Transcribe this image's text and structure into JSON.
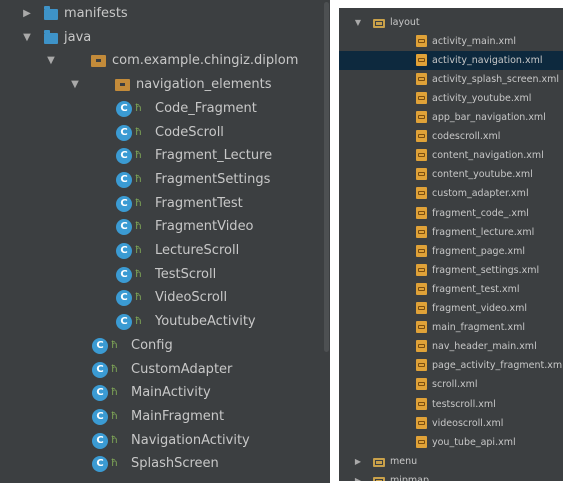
{
  "left_tree": [
    {
      "label": "manifests",
      "indent": 0,
      "type": "folder",
      "arrow": "collapsed"
    },
    {
      "label": "java",
      "indent": 0,
      "type": "folder",
      "arrow": "expanded"
    },
    {
      "label": "com.example.chingiz.diplom",
      "indent": 1,
      "type": "package",
      "arrow": "expanded"
    },
    {
      "label": "navigation_elements",
      "indent": 2,
      "type": "package",
      "arrow": "expanded"
    },
    {
      "label": "Code_Fragment",
      "indent": 3,
      "type": "class"
    },
    {
      "label": "CodeScroll",
      "indent": 3,
      "type": "class"
    },
    {
      "label": "Fragment_Lecture",
      "indent": 3,
      "type": "class"
    },
    {
      "label": "FragmentSettings",
      "indent": 3,
      "type": "class"
    },
    {
      "label": "FragmentTest",
      "indent": 3,
      "type": "class"
    },
    {
      "label": "FragmentVideo",
      "indent": 3,
      "type": "class"
    },
    {
      "label": "LectureScroll",
      "indent": 3,
      "type": "class"
    },
    {
      "label": "TestScroll",
      "indent": 3,
      "type": "class"
    },
    {
      "label": "VideoScroll",
      "indent": 3,
      "type": "class"
    },
    {
      "label": "YoutubeActivity",
      "indent": 3,
      "type": "class"
    },
    {
      "label": "Config",
      "indent": 2,
      "type": "class"
    },
    {
      "label": "CustomAdapter",
      "indent": 2,
      "type": "class"
    },
    {
      "label": "MainActivity",
      "indent": 2,
      "type": "class"
    },
    {
      "label": "MainFragment",
      "indent": 2,
      "type": "class"
    },
    {
      "label": "NavigationActivity",
      "indent": 2,
      "type": "class"
    },
    {
      "label": "SplashScreen",
      "indent": 2,
      "type": "class"
    }
  ],
  "right_tree": [
    {
      "label": "layout",
      "indent": 0,
      "type": "folder",
      "arrow": "expanded"
    },
    {
      "label": "activity_main.xml",
      "indent": 1,
      "type": "xml"
    },
    {
      "label": "activity_navigation.xml",
      "indent": 1,
      "type": "xml",
      "selected": true
    },
    {
      "label": "activity_splash_screen.xml",
      "indent": 1,
      "type": "xml"
    },
    {
      "label": "activity_youtube.xml",
      "indent": 1,
      "type": "xml"
    },
    {
      "label": "app_bar_navigation.xml",
      "indent": 1,
      "type": "xml"
    },
    {
      "label": "codescroll.xml",
      "indent": 1,
      "type": "xml"
    },
    {
      "label": "content_navigation.xml",
      "indent": 1,
      "type": "xml"
    },
    {
      "label": "content_youtube.xml",
      "indent": 1,
      "type": "xml"
    },
    {
      "label": "custom_adapter.xml",
      "indent": 1,
      "type": "xml"
    },
    {
      "label": "fragment_code_.xml",
      "indent": 1,
      "type": "xml"
    },
    {
      "label": "fragment_lecture.xml",
      "indent": 1,
      "type": "xml"
    },
    {
      "label": "fragment_page.xml",
      "indent": 1,
      "type": "xml"
    },
    {
      "label": "fragment_settings.xml",
      "indent": 1,
      "type": "xml"
    },
    {
      "label": "fragment_test.xml",
      "indent": 1,
      "type": "xml"
    },
    {
      "label": "fragment_video.xml",
      "indent": 1,
      "type": "xml"
    },
    {
      "label": "main_fragment.xml",
      "indent": 1,
      "type": "xml"
    },
    {
      "label": "nav_header_main.xml",
      "indent": 1,
      "type": "xml"
    },
    {
      "label": "page_activity_fragment.xml",
      "indent": 1,
      "type": "xml"
    },
    {
      "label": "scroll.xml",
      "indent": 1,
      "type": "xml"
    },
    {
      "label": "testscroll.xml",
      "indent": 1,
      "type": "xml"
    },
    {
      "label": "videoscroll.xml",
      "indent": 1,
      "type": "xml"
    },
    {
      "label": "you_tube_api.xml",
      "indent": 1,
      "type": "xml"
    },
    {
      "label": "menu",
      "indent": 0,
      "type": "folder",
      "arrow": "collapsed"
    },
    {
      "label": "mipmap",
      "indent": 0,
      "type": "folder",
      "arrow": "collapsed"
    }
  ],
  "icons": {
    "class_letter": "C",
    "expanded_arrow": "▼",
    "collapsed_arrow": "▶",
    "lock_glyph": "🔓"
  },
  "colors": {
    "panel_bg": "#3c3f41",
    "selection_bg": "#0d293e",
    "text": "#c8c8c8",
    "folder_blue": "#3e93c8",
    "package_orange": "#c38b3a",
    "class_blue": "#3b9bd3",
    "xml_orange": "#e0a238"
  }
}
